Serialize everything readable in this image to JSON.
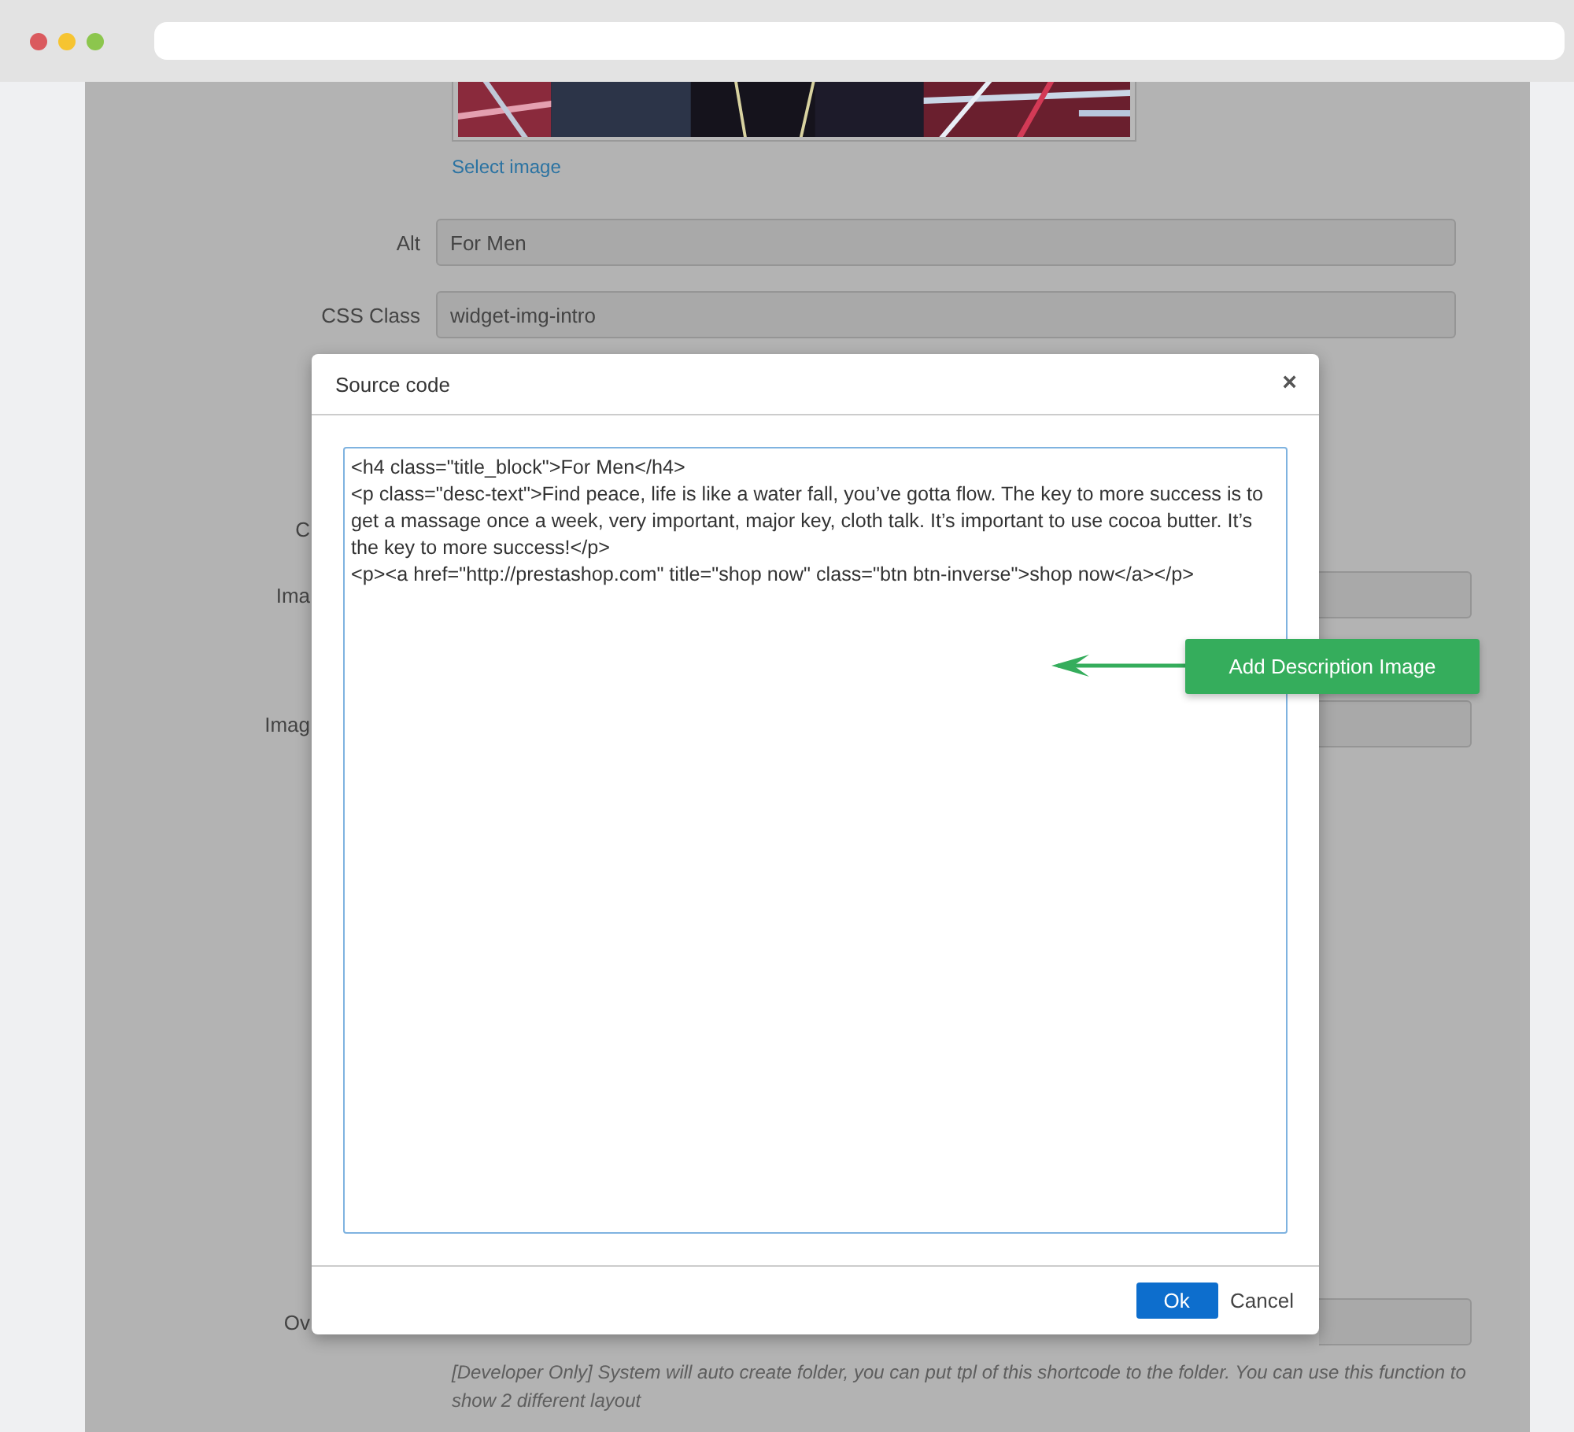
{
  "form": {
    "image_link": "Select image",
    "rows": [
      {
        "kind": "full",
        "label": "Alt",
        "value": "For Men"
      },
      {
        "kind": "full",
        "label": "CSS Class",
        "value": "widget-img-intro"
      },
      {
        "kind": "label",
        "label": "C"
      },
      {
        "kind": "stub",
        "label": "Ima"
      },
      {
        "kind": "stub",
        "label": "Imag"
      },
      {
        "kind": "stub",
        "label": "Ov"
      }
    ],
    "help": "[Developer Only] System will auto create folder, you can put tpl of this shortcode to the folder. You can use this function to show 2 different layout"
  },
  "dialog": {
    "title": "Source code",
    "close": "×",
    "code_lines": [
      "<h4 class=\"title_block\">For Men</h4>",
      "<p class=\"desc-text\">Find peace, life is like a water fall, you’ve gotta flow. The key to more success is to get a massage once a week, very important, major key, cloth talk. It’s important to use cocoa butter. It’s the key to more success!</p>",
      "<p><a href=\"http://prestashop.com\" title=\"shop now\" class=\"btn btn-inverse\">shop now</a></p>"
    ],
    "ok": "Ok",
    "cancel": "Cancel"
  },
  "callout": {
    "label": "Add Description Image"
  }
}
